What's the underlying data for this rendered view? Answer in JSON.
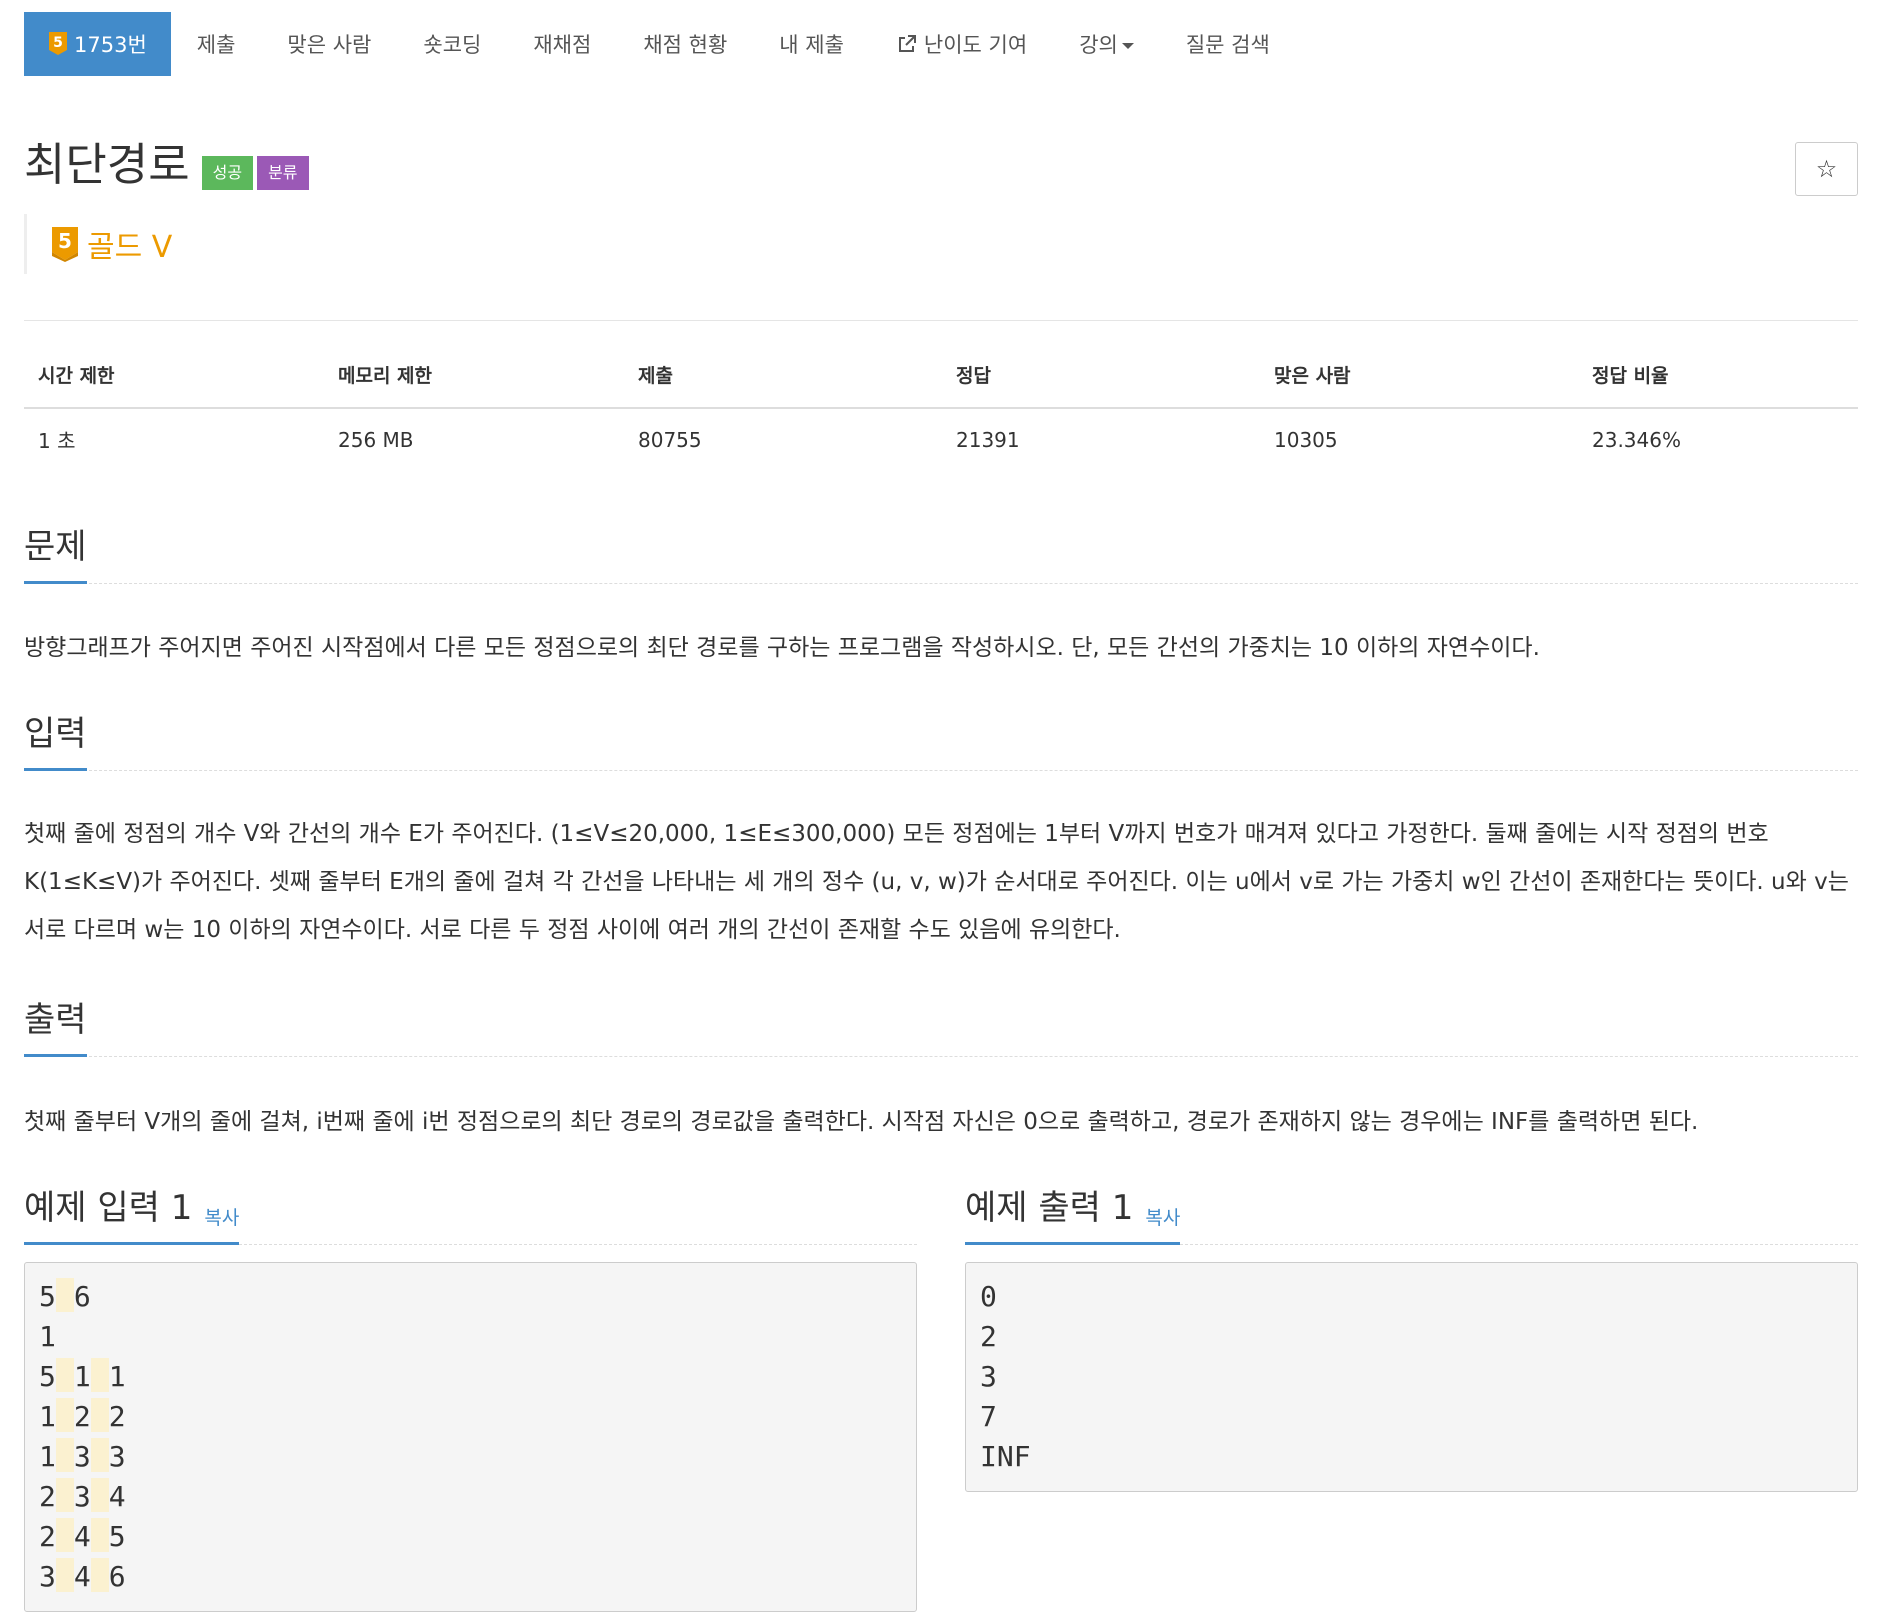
{
  "tabs": [
    {
      "label": "1753번",
      "badge": "5",
      "active": true
    },
    {
      "label": "제출"
    },
    {
      "label": "맞은 사람"
    },
    {
      "label": "숏코딩"
    },
    {
      "label": "재채점"
    },
    {
      "label": "채점 현황"
    },
    {
      "label": "내 제출"
    },
    {
      "label": "난이도 기여",
      "icon": "external-link-icon"
    },
    {
      "label": "강의",
      "icon": "caret-down-icon"
    },
    {
      "label": "질문 검색"
    }
  ],
  "problem": {
    "title": "최단경로",
    "labels": {
      "success": "성공",
      "category": "분류"
    },
    "tier": {
      "badge": "5",
      "text": "골드 V"
    },
    "star": "☆"
  },
  "stats": {
    "headers": [
      "시간 제한",
      "메모리 제한",
      "제출",
      "정답",
      "맞은 사람",
      "정답 비율"
    ],
    "values": [
      "1 초",
      "256 MB",
      "80755",
      "21391",
      "10305",
      "23.346%"
    ]
  },
  "sections": {
    "problem": {
      "title": "문제",
      "text": "방향그래프가 주어지면 주어진 시작점에서 다른 모든 정점으로의 최단 경로를 구하는 프로그램을 작성하시오. 단, 모든 간선의 가중치는 10 이하의 자연수이다."
    },
    "input": {
      "title": "입력",
      "text": "첫째 줄에 정점의 개수 V와 간선의 개수 E가 주어진다. (1≤V≤20,000, 1≤E≤300,000) 모든 정점에는 1부터 V까지 번호가 매겨져 있다고 가정한다. 둘째 줄에는 시작 정점의 번호 K(1≤K≤V)가 주어진다. 셋째 줄부터 E개의 줄에 걸쳐 각 간선을 나타내는 세 개의 정수 (u, v, w)가 순서대로 주어진다. 이는 u에서 v로 가는 가중치 w인 간선이 존재한다는 뜻이다. u와 v는 서로 다르며 w는 10 이하의 자연수이다. 서로 다른 두 정점 사이에 여러 개의 간선이 존재할 수도 있음에 유의한다."
    },
    "output": {
      "title": "출력",
      "text": "첫째 줄부터 V개의 줄에 걸쳐, i번째 줄에 i번 정점으로의 최단 경로의 경로값을 출력한다. 시작점 자신은 0으로 출력하고, 경로가 존재하지 않는 경우에는 INF를 출력하면 된다."
    }
  },
  "samples": {
    "input": {
      "title": "예제 입력 1",
      "copy": "복사",
      "lines": [
        [
          "5",
          "6"
        ],
        [
          "1"
        ],
        [
          "5",
          "1",
          "1"
        ],
        [
          "1",
          "2",
          "2"
        ],
        [
          "1",
          "3",
          "3"
        ],
        [
          "2",
          "3",
          "4"
        ],
        [
          "2",
          "4",
          "5"
        ],
        [
          "3",
          "4",
          "6"
        ]
      ]
    },
    "output": {
      "title": "예제 출력 1",
      "copy": "복사",
      "lines": [
        [
          "0"
        ],
        [
          "2"
        ],
        [
          "3"
        ],
        [
          "7"
        ],
        [
          "INF"
        ]
      ]
    }
  },
  "colors": {
    "accent": "#428bca",
    "success": "#5cb85c",
    "category": "#9b59b6",
    "gold": "#ec9a00"
  }
}
